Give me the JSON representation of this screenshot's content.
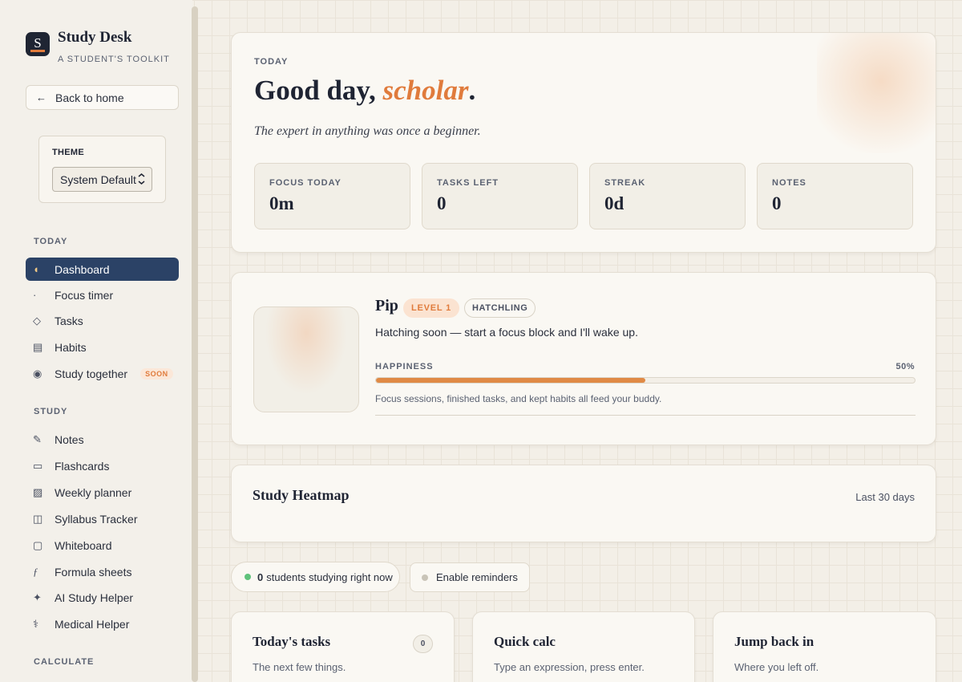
{
  "brand": {
    "logo_letter": "S",
    "name": "Study Desk",
    "tagline": "A STUDENT'S TOOLKIT"
  },
  "sidebar": {
    "back_label": "Back to home",
    "theme": {
      "label": "THEME",
      "selected": "System Default"
    },
    "sections": {
      "today": {
        "title": "TODAY",
        "items": [
          {
            "icon": "moon-icon",
            "label": "Dashboard",
            "active": true
          },
          {
            "icon": "dot-icon",
            "label": "Focus timer"
          },
          {
            "icon": "diamond-icon",
            "label": "Tasks"
          },
          {
            "icon": "calendar-grid-icon",
            "label": "Habits"
          },
          {
            "icon": "target-icon",
            "label": "Study together",
            "badge": "SOON"
          }
        ]
      },
      "study": {
        "title": "STUDY",
        "items": [
          {
            "icon": "pencil-icon",
            "label": "Notes"
          },
          {
            "icon": "card-icon",
            "label": "Flashcards"
          },
          {
            "icon": "planner-icon",
            "label": "Weekly planner"
          },
          {
            "icon": "columns-icon",
            "label": "Syllabus Tracker"
          },
          {
            "icon": "square-icon",
            "label": "Whiteboard"
          },
          {
            "icon": "function-icon",
            "label": "Formula sheets"
          },
          {
            "icon": "sparkle-icon",
            "label": "AI Study Helper"
          },
          {
            "icon": "caduceus-icon",
            "label": "Medical Helper"
          }
        ]
      },
      "calculate": {
        "title": "CALCULATE"
      }
    }
  },
  "hero": {
    "eyebrow": "TODAY",
    "greeting": "Good day, ",
    "name": "scholar",
    "punct": ".",
    "quote": "The expert in anything was once a beginner.",
    "stats": [
      {
        "label": "FOCUS TODAY",
        "value": "0m"
      },
      {
        "label": "TASKS LEFT",
        "value": "0"
      },
      {
        "label": "STREAK",
        "value": "0d"
      },
      {
        "label": "NOTES",
        "value": "0"
      }
    ]
  },
  "pet": {
    "name": "Pip",
    "level": "LEVEL 1",
    "stage": "HATCHLING",
    "message": "Hatching soon — start a focus block and I'll wake up.",
    "happiness_label": "HAPPINESS",
    "happiness_value": 0.5,
    "happiness_text": "50%",
    "note": "Focus sessions, finished tasks, and kept habits all feed your buddy."
  },
  "heatmap": {
    "title": "Study Heatmap",
    "range": "Last 30 days"
  },
  "presence": {
    "count": "0",
    "text": "students studying right now"
  },
  "reminders": {
    "label": "Enable reminders"
  },
  "widgets": {
    "tasks": {
      "title": "Today's tasks",
      "subtitle": "The next few things.",
      "count": "0"
    },
    "calc": {
      "title": "Quick calc",
      "subtitle": "Type an expression, press enter."
    },
    "jump": {
      "title": "Jump back in",
      "subtitle": "Where you left off."
    }
  },
  "colors": {
    "accent": "#e07b3c",
    "active_nav": "#2b4266",
    "live": "#5fc27b"
  }
}
